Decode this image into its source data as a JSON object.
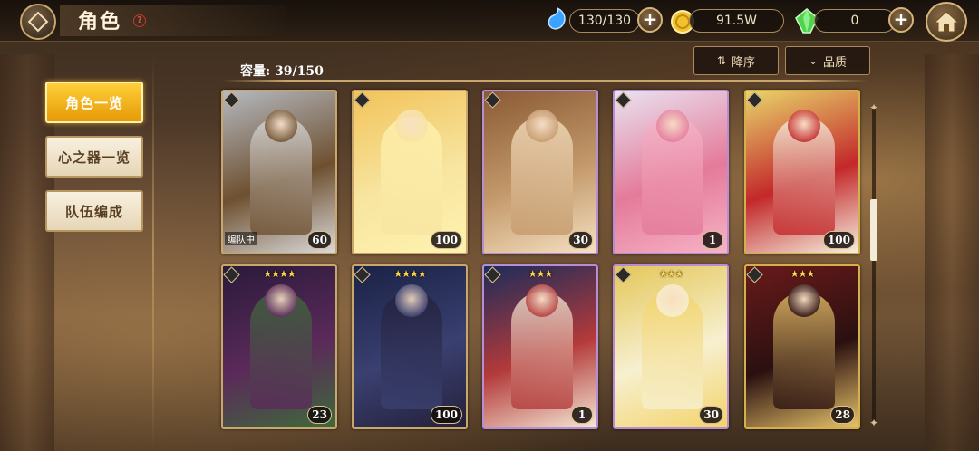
{
  "header": {
    "title": "角色",
    "help_symbol": "?",
    "stamina": "130/130",
    "gold": "91.5W",
    "gems": "0",
    "plus_symbol": "+"
  },
  "sidebar": {
    "items": [
      {
        "label": "角色一览",
        "active": true
      },
      {
        "label": "心之器一览",
        "active": false
      },
      {
        "label": "队伍编成",
        "active": false
      }
    ]
  },
  "toolbar": {
    "capacity": "容量: 39/150",
    "sort_label": "降序",
    "sort_icon": "sort-descending-icon",
    "filter_label": "品质",
    "filter_icon": "chevron-down-icon"
  },
  "cards": [
    {
      "stars": "",
      "level": "60",
      "tag": "编队中",
      "colors": [
        "#b5b9c0",
        "#6e5030",
        "#d9d9d9"
      ]
    },
    {
      "stars": "",
      "level": "100",
      "tag": "",
      "colors": [
        "#f2c35a",
        "#f7e5a0",
        "#fff2b0"
      ]
    },
    {
      "stars": "",
      "level": "30",
      "tag": "",
      "colors": [
        "#8a5a34",
        "#c49a6c",
        "#f5e0c0"
      ]
    },
    {
      "stars": "",
      "level": "1",
      "tag": "",
      "colors": [
        "#e9e2f0",
        "#e47a9a",
        "#f6b3c6"
      ]
    },
    {
      "stars": "",
      "level": "100",
      "tag": "",
      "colors": [
        "#e8d46a",
        "#c3282a",
        "#f5f0e0"
      ]
    },
    {
      "stars": "★★★★",
      "level": "23",
      "tag": "",
      "colors": [
        "#2a1a3a",
        "#5b2a5a",
        "#3d6a3a"
      ]
    },
    {
      "stars": "★★★★",
      "level": "100",
      "tag": "",
      "colors": [
        "#1a2246",
        "#3a4070",
        "#23203a"
      ]
    },
    {
      "stars": "★★★",
      "level": "1",
      "tag": "",
      "colors": [
        "#1c2c5a",
        "#b33a3a",
        "#f4e7d4"
      ]
    },
    {
      "stars": "★★★",
      "level": "30",
      "tag": "",
      "colors": [
        "#e4c75a",
        "#f7f0d0",
        "#f3d36a"
      ]
    },
    {
      "stars": "★★★",
      "level": "28",
      "tag": "",
      "colors": [
        "#6a1a1a",
        "#2a1010",
        "#e8c36a"
      ]
    }
  ]
}
